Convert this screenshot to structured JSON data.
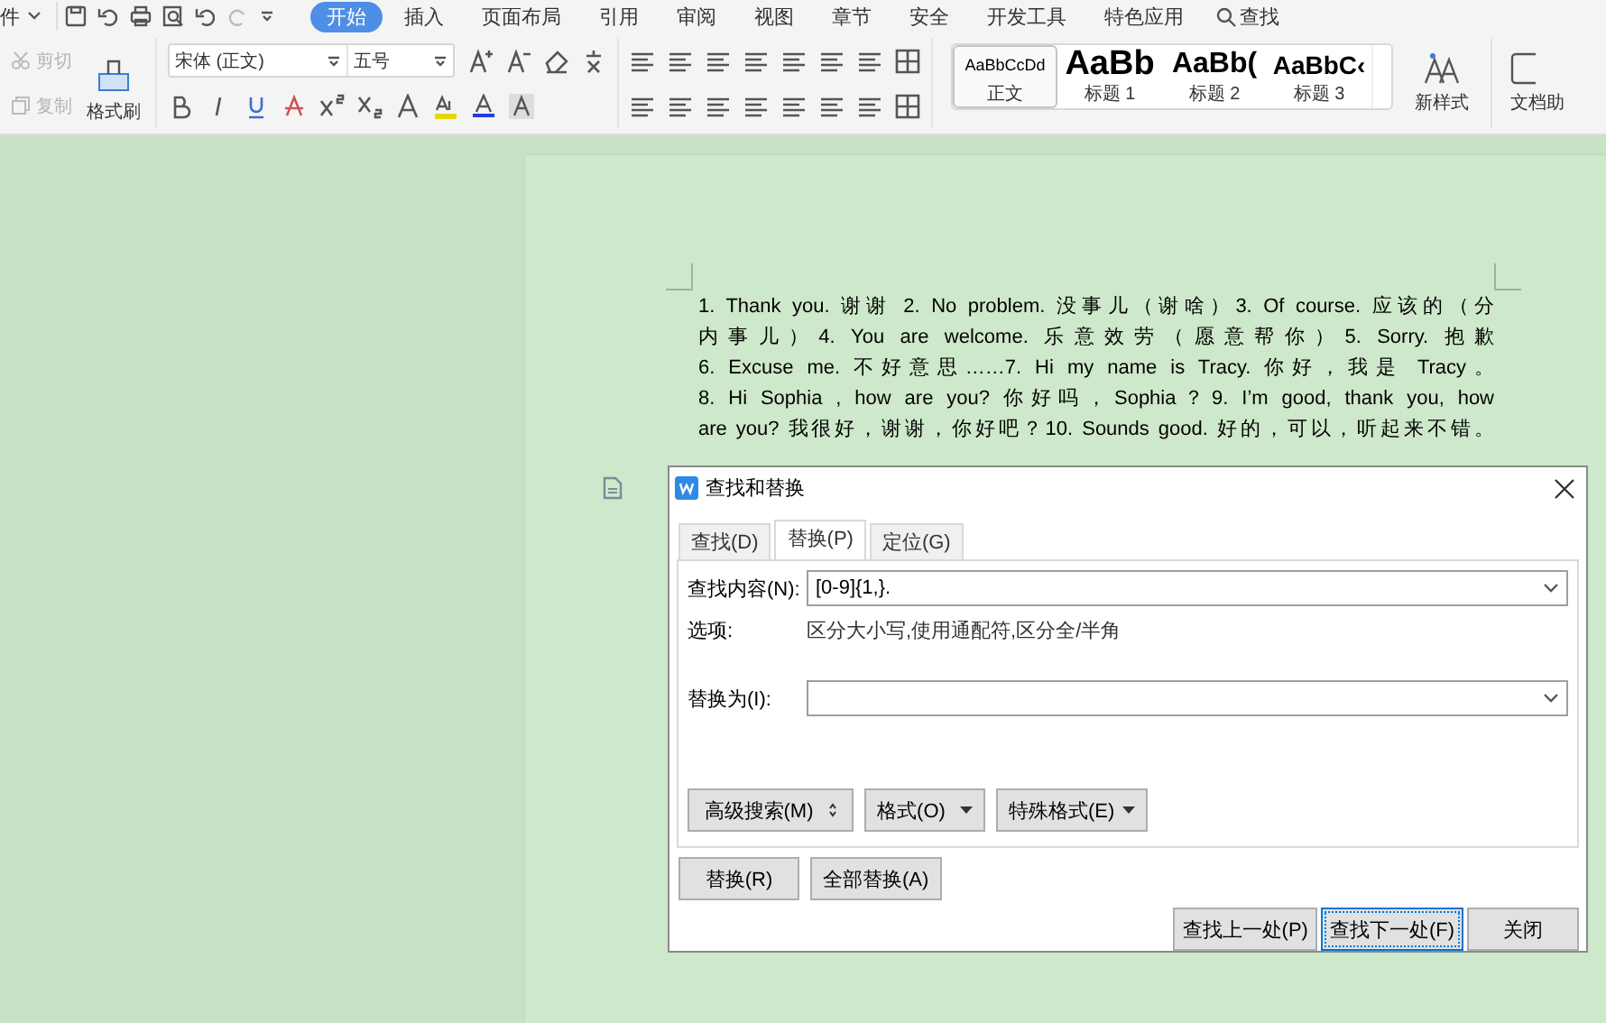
{
  "menubar": {
    "file_partial": "件",
    "tabs": [
      {
        "label": "开始",
        "selected": true
      },
      {
        "label": "插入",
        "selected": false
      },
      {
        "label": "页面布局",
        "selected": false
      },
      {
        "label": "引用",
        "selected": false
      },
      {
        "label": "审阅",
        "selected": false
      },
      {
        "label": "视图",
        "selected": false
      },
      {
        "label": "章节",
        "selected": false
      },
      {
        "label": "安全",
        "selected": false
      },
      {
        "label": "开发工具",
        "selected": false
      },
      {
        "label": "特色应用",
        "selected": false
      }
    ],
    "search": "查找"
  },
  "ribbon": {
    "clipboard": [
      {
        "label": "剪切",
        "disabled": true
      },
      {
        "label": "复制",
        "disabled": true
      }
    ],
    "format_painter": "格式刷",
    "font_name": "宋体 (正文)",
    "font_size": "五号",
    "styles": [
      {
        "kind": "body",
        "preview": "AaBbCcDd",
        "label": "正文",
        "selected": true
      },
      {
        "kind": "h1",
        "preview": "AaBb",
        "label": "标题 1",
        "selected": false
      },
      {
        "kind": "h2",
        "preview": "AaBb(",
        "label": "标题 2",
        "selected": false
      },
      {
        "kind": "h3",
        "preview": "AaBbC‹",
        "label": "标题 3",
        "selected": false
      }
    ],
    "new_style": "新样式",
    "doc_helper": "文档助"
  },
  "document": {
    "lines": [
      "1. Thank you. 谢谢 2. No problem. 没事儿（谢啥）3. Of course. 应该的（分",
      "内事儿）4. You are welcome. 乐意效劳（愿意帮你）5. Sorry. 抱歉",
      "6. Excuse me. 不好意思……7. Hi my name is Tracy. 你好，我是 Tracy。",
      "8. Hi Sophia , how are you? 你好吗，Sophia？9. I’m good, thank you, how",
      "are you? 我很好，谢谢，你好吧？10. Sounds good. 好的，可以，听起来不错。"
    ]
  },
  "dialog": {
    "title": "查找和替换",
    "tabs": [
      {
        "label": "查找(D)",
        "selected": false
      },
      {
        "label": "替换(P)",
        "selected": true
      },
      {
        "label": "定位(G)",
        "selected": false
      }
    ],
    "find_label": "查找内容(N):",
    "find_value": "[0-9]{1,}.",
    "options_label": "选项:",
    "options_value": "区分大小写,使用通配符,区分全/半角",
    "replace_label": "替换为(I):",
    "panel_buttons": [
      {
        "label": "高级搜索(M)",
        "kind": "more"
      },
      {
        "label": "格式(O)",
        "kind": "menu"
      },
      {
        "label": "特殊格式(E)",
        "kind": "menu"
      }
    ],
    "replace_buttons": [
      "替换(R)",
      "全部替换(A)"
    ],
    "bottom_buttons": [
      {
        "label": "查找上一处(P)",
        "focused": false
      },
      {
        "label": "查找下一处(F)",
        "focused": true
      },
      {
        "label": "关闭",
        "focused": false
      }
    ]
  }
}
